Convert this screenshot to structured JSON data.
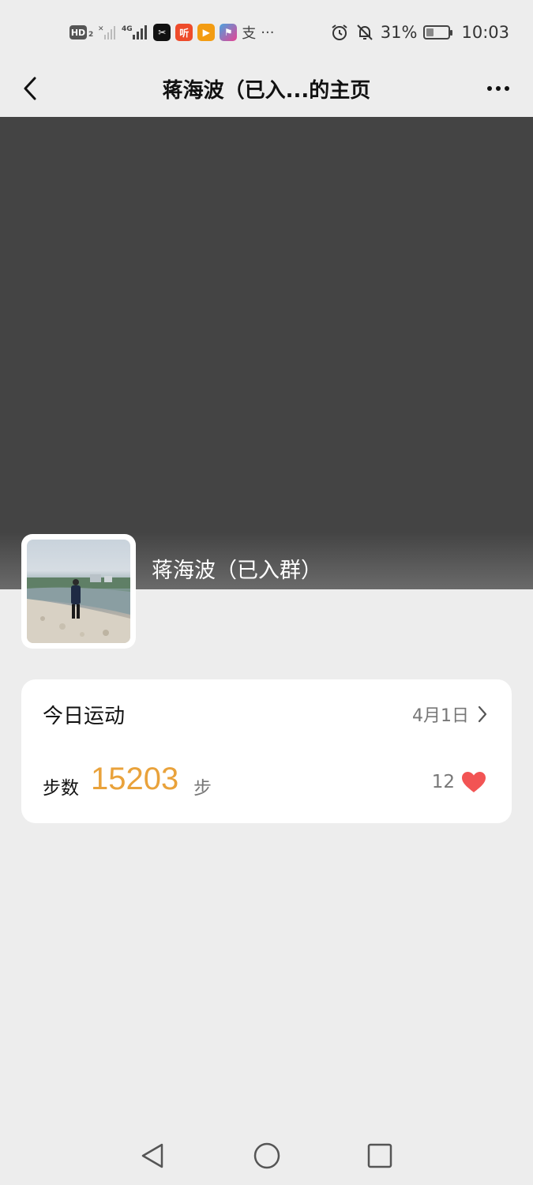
{
  "status_bar": {
    "hd_label": "HD",
    "hd_sub": "2",
    "app_icons": [
      {
        "name": "capcut-icon",
        "color": "#111111",
        "glyph": "✂"
      },
      {
        "name": "ting-icon",
        "color": "#ee4b2b",
        "glyph": "听"
      },
      {
        "name": "play-icon",
        "color": "#f39c12",
        "glyph": "▶"
      },
      {
        "name": "flag-app-icon",
        "color": "#4aa3df",
        "glyph": "⚑"
      }
    ],
    "extra_glyph": "支",
    "more": "···",
    "battery": "31%",
    "battery_level": 0.31,
    "time": "10:03"
  },
  "nav": {
    "title": "蒋海波（已入...的主页"
  },
  "profile": {
    "name": "蒋海波（已入群）"
  },
  "card": {
    "title": "今日运动",
    "date": "4月1日",
    "steps_label": "步数",
    "steps_value": "15203",
    "steps_unit": "步",
    "likes": "12"
  },
  "colors": {
    "accent": "#e9a23b",
    "heart": "#f25454",
    "cover": "#444444"
  }
}
